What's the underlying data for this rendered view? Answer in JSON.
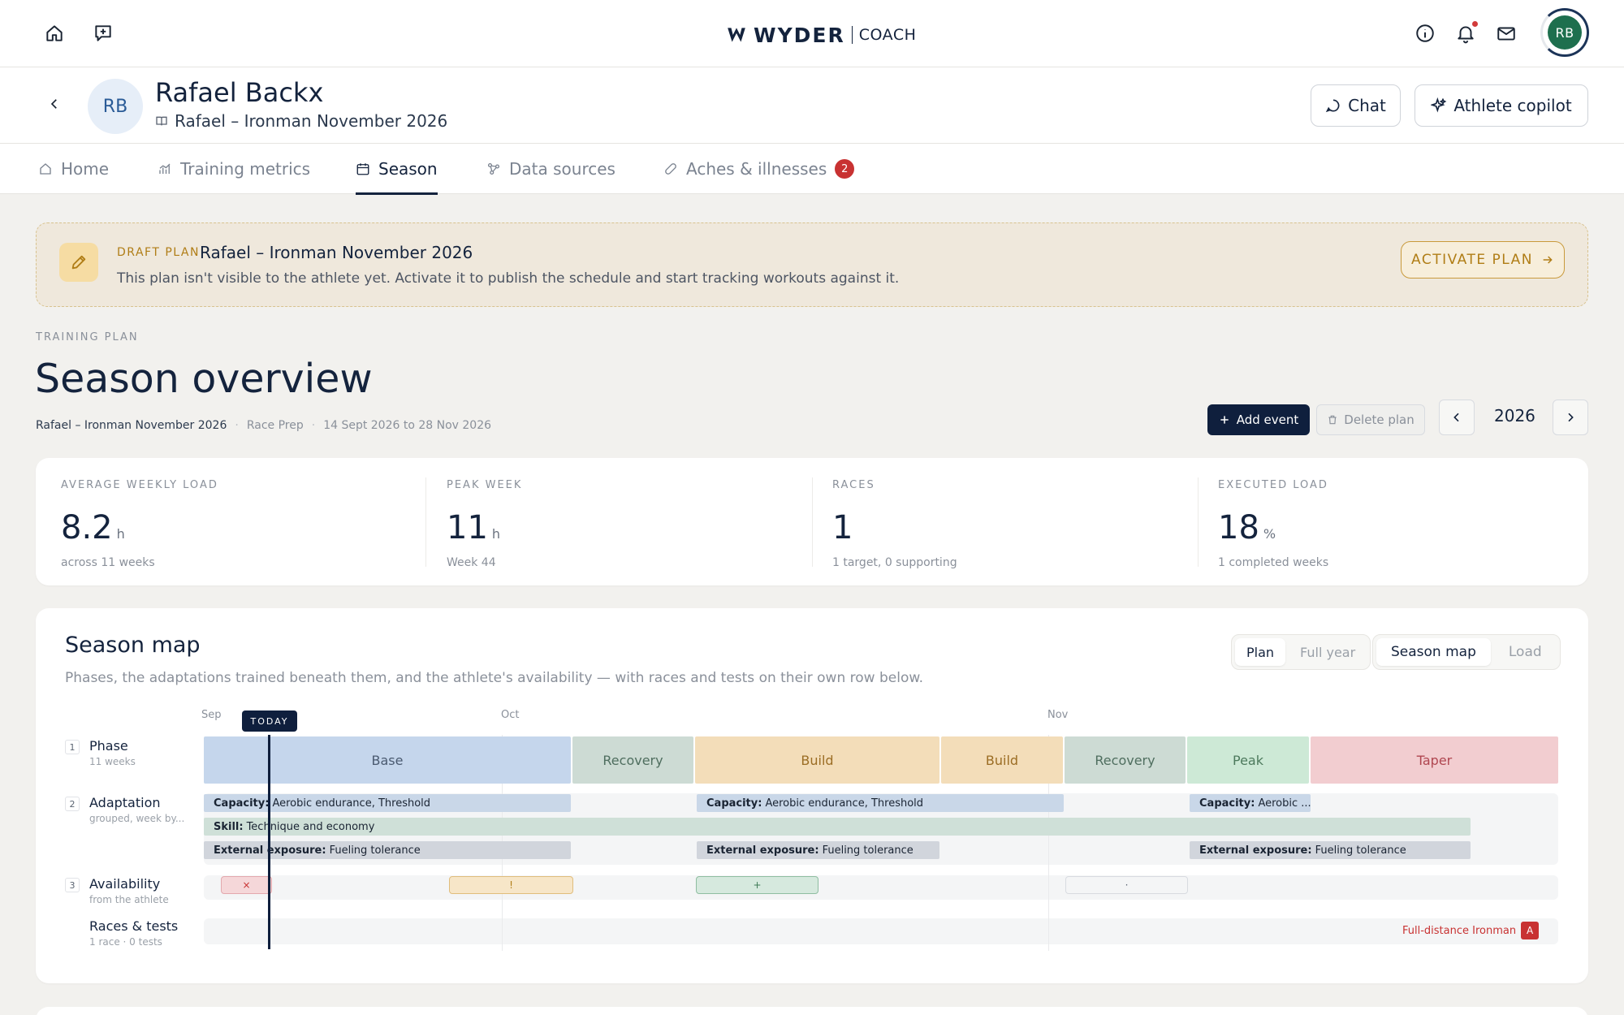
{
  "brand": {
    "word": "WYDER",
    "sub": "COACH",
    "avatar_initials": "RB"
  },
  "icons": {
    "home": "home-icon",
    "compose": "chat-plus-icon",
    "info": "info-icon",
    "bell": "bell-icon",
    "mail": "mail-icon"
  },
  "athlete": {
    "initials": "RB",
    "name": "Rafael Backx",
    "plan": "Rafael – Ironman November 2026"
  },
  "header_buttons": {
    "chat": "Chat",
    "copilot": "Athlete copilot"
  },
  "tabs": [
    {
      "label": "Home"
    },
    {
      "label": "Training metrics"
    },
    {
      "label": "Season"
    },
    {
      "label": "Data sources"
    },
    {
      "label": "Aches & illnesses",
      "badge": "2"
    }
  ],
  "draft": {
    "tag": "DRAFT PLAN",
    "title": "Rafael – Ironman November 2026",
    "description": "This plan isn't visible to the athlete yet. Activate it to publish the schedule and start tracking workouts against it.",
    "button": "ACTIVATE PLAN"
  },
  "overview": {
    "eyebrow": "TRAINING PLAN",
    "title": "Season overview",
    "meta": {
      "plan": "Rafael – Ironman November 2026",
      "type": "Race Prep",
      "dates": "14 Sept 2026 to 28 Nov 2026"
    },
    "add_event": "Add event",
    "delete_plan": "Delete plan",
    "year": "2026"
  },
  "stats": [
    {
      "label": "AVERAGE WEEKLY LOAD",
      "value": "8.2",
      "unit": "h",
      "sub": "across 11 weeks"
    },
    {
      "label": "PEAK WEEK",
      "value": "11",
      "unit": "h",
      "sub": "Week 44"
    },
    {
      "label": "RACES",
      "value": "1",
      "unit": "",
      "sub": "1 target, 0 supporting"
    },
    {
      "label": "EXECUTED LOAD",
      "value": "18",
      "unit": "%",
      "sub": "1 completed weeks"
    }
  ],
  "season_map": {
    "title": "Season map",
    "description": "Phases, the adaptations trained beneath them, and the athlete's availability — with races and tests on their own row below.",
    "range_toggle": {
      "plan": "Plan",
      "full_year": "Full year"
    },
    "view_toggle": {
      "season_map": "Season map",
      "load": "Load"
    },
    "months": [
      "Sep",
      "Oct",
      "Nov"
    ],
    "today": "TODAY",
    "rows": {
      "phase": {
        "num": "1",
        "name": "Phase",
        "sub": "11 weeks"
      },
      "adaptation": {
        "num": "2",
        "name": "Adaptation",
        "sub": "grouped, week by..."
      },
      "availability": {
        "num": "3",
        "name": "Availability",
        "sub": "from the athlete"
      },
      "races": {
        "name": "Races & tests",
        "sub": "1 race · 0 tests"
      }
    },
    "phases": [
      {
        "label": "Base",
        "color": "#c5d6ec",
        "text": "#4a5a70"
      },
      {
        "label": "Recovery",
        "color": "#cddbd4",
        "text": "#4f6e5f"
      },
      {
        "label": "Build",
        "color": "#f3ddb9",
        "text": "#9b6d24"
      },
      {
        "label": "Build",
        "color": "#f3ddb9",
        "text": "#9b6d24"
      },
      {
        "label": "Recovery",
        "color": "#cddbd4",
        "text": "#4f6e5f"
      },
      {
        "label": "Peak",
        "color": "#cde9d6",
        "text": "#4d7a5d"
      },
      {
        "label": "Taper",
        "color": "#f2cdd0",
        "text": "#b04650"
      }
    ],
    "adaptations": [
      {
        "kind": "Capacity:",
        "text": "Aerobic endurance, Threshold"
      },
      {
        "kind": "Capacity:",
        "text": "Aerobic endurance, Threshold"
      },
      {
        "kind": "Capacity:",
        "text": "Aerobic ..."
      },
      {
        "kind": "Skill:",
        "text": "Technique and economy"
      },
      {
        "kind": "External exposure:",
        "text": "Fueling tolerance"
      },
      {
        "kind": "External exposure:",
        "text": "Fueling tolerance"
      },
      {
        "kind": "External exposure:",
        "text": "Fueling tolerance"
      }
    ],
    "availability_marks": [
      "×",
      "!",
      "+",
      "·"
    ],
    "race": {
      "label": "Full-distance Ironman",
      "priority": "A"
    }
  }
}
